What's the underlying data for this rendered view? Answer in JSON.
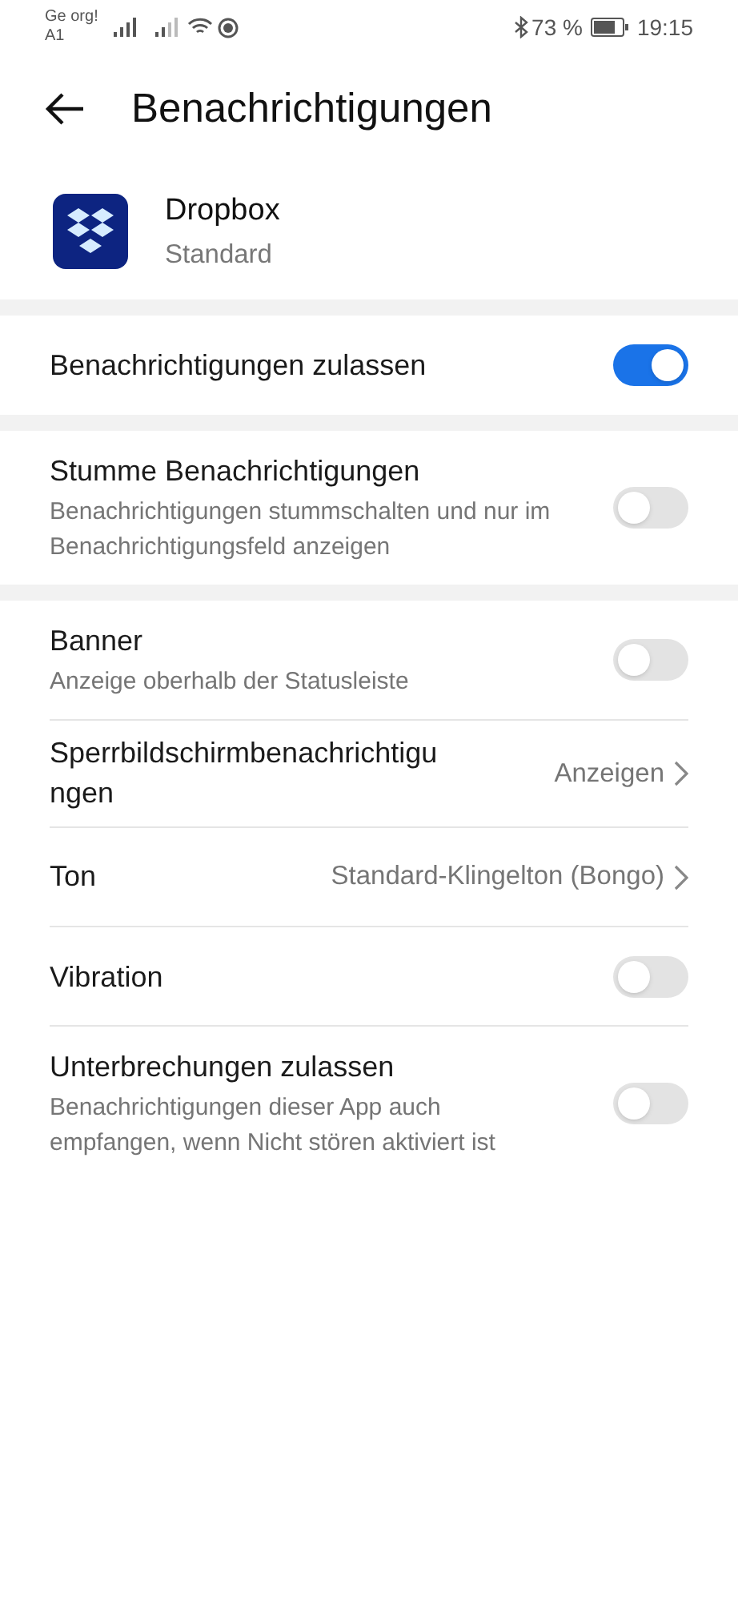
{
  "status_bar": {
    "carrier": "Ge org!",
    "carrier_2": "A1",
    "battery": "73 %",
    "time": "19:15"
  },
  "header": {
    "title": "Benachrichtigungen"
  },
  "app": {
    "name": "Dropbox",
    "subtitle": "Standard"
  },
  "sections": [
    {
      "rows": [
        {
          "kind": "toggle",
          "title": "Benachrichtigungen zulassen",
          "on": true
        }
      ]
    },
    {
      "rows": [
        {
          "kind": "toggle",
          "title": "Stumme Benachrichtigungen",
          "subtitle": "Benachrichtigungen stummschalten und nur im Benachrichtigungsfeld anzeigen",
          "on": false
        }
      ]
    },
    {
      "rows": [
        {
          "kind": "toggle",
          "title": "Banner",
          "subtitle": "Anzeige oberhalb der Statusleiste",
          "on": false
        },
        {
          "kind": "link",
          "title": "Sperrbildschirmbenachrichtigungen",
          "value": "Anzeigen"
        },
        {
          "kind": "link",
          "title": "Ton",
          "value": "Standard-Klingelton (Bongo)"
        },
        {
          "kind": "toggle",
          "title": "Vibration",
          "on": false
        },
        {
          "kind": "toggle",
          "title": "Unterbrechungen zulassen",
          "subtitle": "Benachrichtigungen dieser App auch empfangen, wenn Nicht stören aktiviert ist",
          "on": false
        }
      ]
    }
  ]
}
